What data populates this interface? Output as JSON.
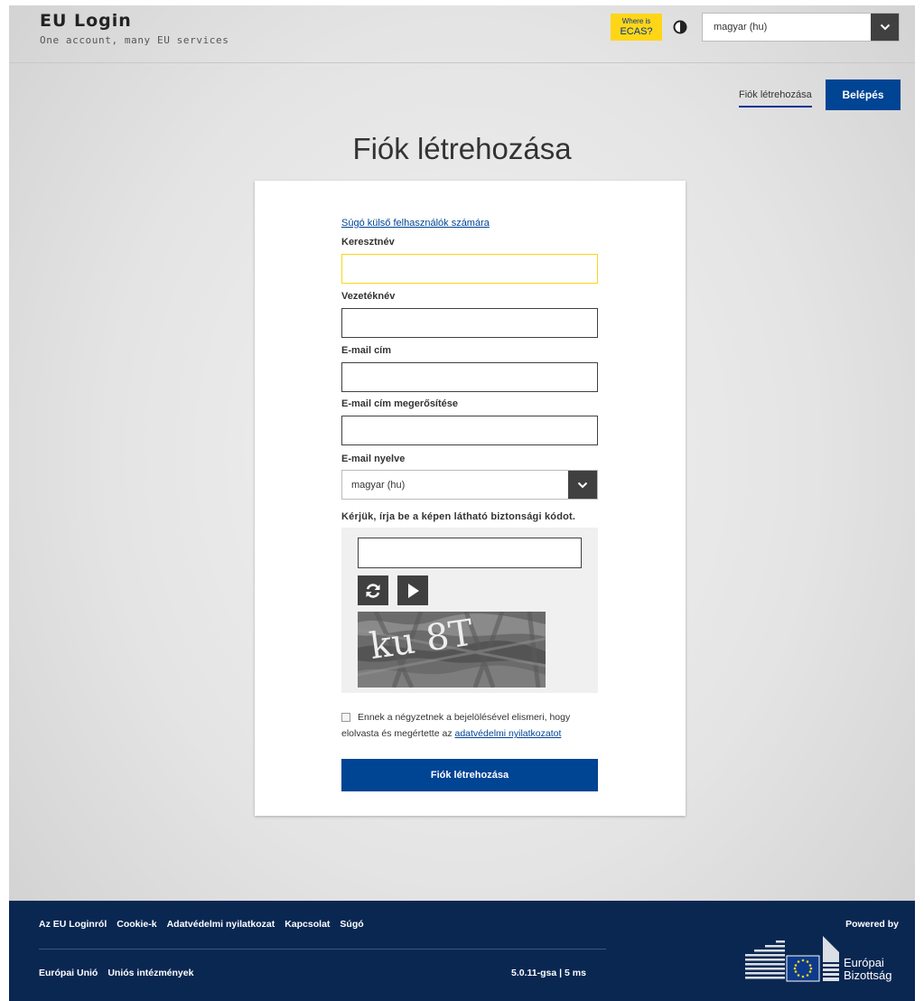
{
  "header": {
    "brand_title": "EU Login",
    "brand_tagline": "One account, many EU services",
    "ecas_small": "Where is",
    "ecas_big": "ECAS?",
    "language": "magyar (hu)"
  },
  "nav": {
    "create_account": "Fiók létrehozása",
    "login": "Belépés"
  },
  "page_title": "Fiók létrehozása",
  "form": {
    "help_link": "Súgó külső felhasználók számára",
    "first_name_label": "Keresztnév",
    "first_name_value": "",
    "last_name_label": "Vezetéknév",
    "last_name_value": "",
    "email_label": "E-mail cím",
    "email_value": "",
    "email_confirm_label": "E-mail cím megerősítése",
    "email_confirm_value": "",
    "email_language_label": "E-mail nyelve",
    "email_language_value": "magyar (hu)",
    "captcha_label": "Kérjük, írja be a képen látható biztonsági kódot.",
    "captcha_value": "",
    "captcha_image_text": "ku 8T",
    "consent_text": "Ennek a négyzetnek a bejelölésével elismeri, hogy elolvasta és megértette az",
    "consent_link": "adatvédelmi nyilatkozatot",
    "consent_checked": false,
    "submit_label": "Fiók létrehozása"
  },
  "footer": {
    "links_row1": [
      "Az EU Loginról",
      "Cookie-k",
      "Adatvédelmi nyilatkozat",
      "Kapcsolat",
      "Súgó"
    ],
    "links_row2": [
      "Európai Unió",
      "Uniós intézmények"
    ],
    "version": "5.0.11-gsa | 5 ms",
    "powered_by": "Powered by",
    "logo_line1": "Európai",
    "logo_line2": "Bizottság"
  },
  "colors": {
    "primary": "#004494",
    "ecas_badge": "#ffd617",
    "footer_bg": "#0a2752",
    "select_arrow_bg": "#404040"
  },
  "icons": {
    "contrast": "contrast-icon",
    "chevron": "chevron-down-icon",
    "refresh": "refresh-icon",
    "play": "play-audio-icon"
  }
}
